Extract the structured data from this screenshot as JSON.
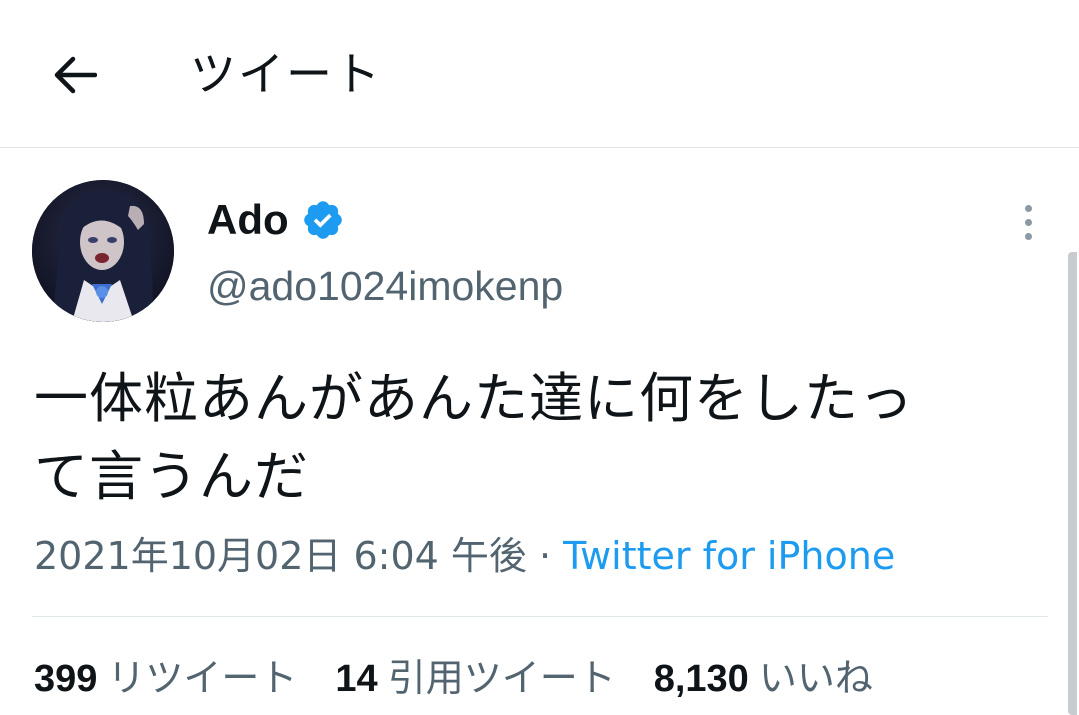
{
  "header": {
    "title": "ツイート",
    "back_icon": "arrow-left-icon"
  },
  "tweet": {
    "author": {
      "display_name": "Ado",
      "handle": "@ado1024imokenp",
      "verified": true,
      "badge_color": "#1d9bf0"
    },
    "text_line1": "一体粒あんがあんた達に何をしたっ",
    "text_line2": "て言うんだ",
    "timestamp": "2021年10月02日 6:04 午後",
    "separator": " · ",
    "source": "Twitter for iPhone"
  },
  "stats": {
    "retweets": {
      "count": "399",
      "label": "リツイート"
    },
    "quotes": {
      "count": "14",
      "label": "引用ツイート"
    },
    "likes": {
      "count": "8,130",
      "label": "いいね"
    }
  },
  "colors": {
    "text_primary": "#0f1419",
    "text_secondary": "#536471",
    "link": "#1d9bf0",
    "divider": "#e1e6ea"
  }
}
